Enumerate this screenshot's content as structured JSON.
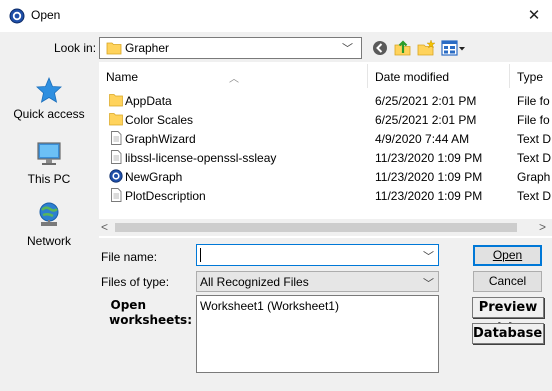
{
  "window": {
    "title": "Open",
    "close_glyph": "✕"
  },
  "look_in": {
    "label": "Look in:",
    "value": "Grapher"
  },
  "toolbar": {
    "icons": [
      "back-icon",
      "up-folder-icon",
      "new-folder-icon",
      "view-menu-icon"
    ]
  },
  "places": [
    {
      "label": "Quick access",
      "icon": "star-icon"
    },
    {
      "label": "This PC",
      "icon": "computer-icon"
    },
    {
      "label": "Network",
      "icon": "network-icon"
    }
  ],
  "columns": {
    "name": "Name",
    "date": "Date modified",
    "type": "Type"
  },
  "files": [
    {
      "name": "AppData",
      "date": "6/25/2021 2:01 PM",
      "type": "File fo",
      "icon": "folder"
    },
    {
      "name": "Color Scales",
      "date": "6/25/2021 2:01 PM",
      "type": "File fo",
      "icon": "folder"
    },
    {
      "name": "GraphWizard",
      "date": "4/9/2020 7:44 AM",
      "type": "Text D",
      "icon": "doc"
    },
    {
      "name": "libssl-license-openssl-ssleay",
      "date": "11/23/2020 1:09 PM",
      "type": "Text D",
      "icon": "doc"
    },
    {
      "name": "NewGraph",
      "date": "11/23/2020 1:09 PM",
      "type": "Graph",
      "icon": "grapher"
    },
    {
      "name": "PlotDescription",
      "date": "11/23/2020 1:09 PM",
      "type": "Text D",
      "icon": "doc"
    }
  ],
  "file_name": {
    "label": "File name:",
    "value": ""
  },
  "file_type": {
    "label": "Files of type:",
    "value": "All Recognized Files"
  },
  "buttons": {
    "open": "Open",
    "cancel": "Cancel",
    "preview": "Preview >>",
    "database": "Database..."
  },
  "open_worksheets": {
    "label_line1": "Open",
    "label_line2": "worksheets:",
    "items": [
      "Worksheet1 (Worksheet1)"
    ]
  },
  "colors": {
    "accent": "#0078d7",
    "folder": "#ffd35c",
    "grapher_blue": "#1f4fa8"
  }
}
